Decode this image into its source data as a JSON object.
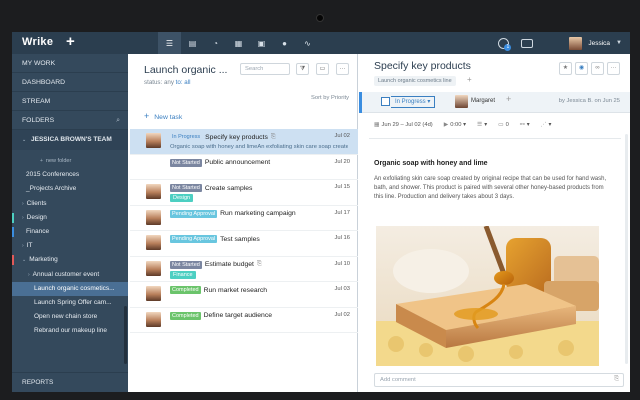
{
  "app": {
    "logo": "Wrike",
    "user_name": "Jessica",
    "notif_count": "1"
  },
  "topnav": [
    {
      "name": "nav-list-icon",
      "glyph": "☰",
      "active": true
    },
    {
      "name": "nav-table-icon",
      "glyph": "▤",
      "active": false
    },
    {
      "name": "nav-timeline-icon",
      "glyph": "◔",
      "active": false
    },
    {
      "name": "nav-calendar-icon",
      "glyph": "▦",
      "active": false
    },
    {
      "name": "nav-board-icon",
      "glyph": "▣",
      "active": false
    },
    {
      "name": "nav-workload-icon",
      "glyph": "●",
      "active": false
    },
    {
      "name": "nav-reports-icon",
      "glyph": "∿",
      "active": false
    }
  ],
  "sidebar": {
    "sections": [
      "MY WORK",
      "DASHBOARD",
      "STREAM",
      "FOLDERS"
    ],
    "team": "JESSICA BROWN'S TEAM",
    "items": [
      {
        "label": "new folder",
        "indent": 28,
        "small": true,
        "arrow": "+"
      },
      {
        "label": "2015 Conferences",
        "indent": 14
      },
      {
        "label": "_Projects Archive",
        "indent": 14
      },
      {
        "label": "Clients",
        "indent": 10,
        "arrow": "›"
      },
      {
        "label": "Design",
        "indent": 10,
        "arrow": "›",
        "bar": "#4dcfc2"
      },
      {
        "label": "Finance",
        "indent": 14,
        "bar": "#3a8de0"
      },
      {
        "label": "IT",
        "indent": 10,
        "arrow": "›"
      },
      {
        "label": "Marketing",
        "indent": 10,
        "arrow": "⌄",
        "bar": "#e05a5a"
      },
      {
        "label": "Annual customer event",
        "indent": 16,
        "arrow": "›"
      },
      {
        "label": "Launch organic cosmetics...",
        "indent": 22,
        "selected": true
      },
      {
        "label": "Launch Spring Offer cam...",
        "indent": 22
      },
      {
        "label": "Open new chain store",
        "indent": 22
      },
      {
        "label": "Rebrand our makeup line",
        "indent": 22
      }
    ],
    "reports": "REPORTS"
  },
  "list": {
    "title": "Launch organic ...",
    "status_label": "status: any",
    "to_label": "to: all",
    "search_placeholder": "Search",
    "sort_label": "Sort by Priority",
    "new_task": "New task",
    "tasks": [
      {
        "status": "In Progress",
        "cls": "b-inprogress",
        "title": "Specify key products",
        "attach": true,
        "date": "Jul 02",
        "snippet": "Organic soap with honey and limeAn exfoliating skin care soap created by",
        "selected": true,
        "avatar": true
      },
      {
        "status": "Not Started",
        "cls": "b-notstarted",
        "title": "Public announcement",
        "date": "Jul 20",
        "avatar": false
      },
      {
        "status": "Not Started",
        "cls": "b-notstarted",
        "title": "Create samples",
        "date": "Jul 15",
        "tag": "Design",
        "avatar": true
      },
      {
        "status": "Pending Approval",
        "cls": "b-pending",
        "title": "Run marketing campaign",
        "date": "Jul 17",
        "avatar": true
      },
      {
        "status": "Pending Approval",
        "cls": "b-pending",
        "title": "Test samples",
        "date": "Jul 16",
        "avatar": true
      },
      {
        "status": "Not Started",
        "cls": "b-notstarted",
        "title": "Estimate budget",
        "attach": true,
        "date": "Jul 10",
        "tag": "Finance",
        "avatar": true
      },
      {
        "status": "Completed",
        "cls": "b-completed",
        "title": "Run market research",
        "date": "Jul 03",
        "avatar": true
      },
      {
        "status": "Completed",
        "cls": "b-completed",
        "title": "Define target audience",
        "date": "Jul 02",
        "avatar": true
      }
    ]
  },
  "details": {
    "title": "Specify key products",
    "folder_chip": "Launch organic cosmetics line",
    "status": "In Progress",
    "assignee": "Margaret",
    "created_by": "by Jessica B. on Jun 25",
    "dates": "Jun 29 – Jul 02 (4d)",
    "timer": "0:00",
    "count": "0",
    "heading": "Organic soap with honey and lime",
    "body": "An exfoliating skin care soap created by original recipe that can be used for hand wash, bath, and shower. This product is paired with several other honey-based products from this line. Production and delivery takes about 3 days.",
    "comment_placeholder": "Add comment"
  }
}
